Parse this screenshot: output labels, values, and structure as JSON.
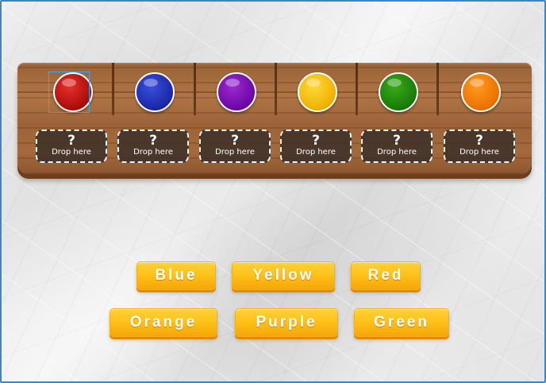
{
  "slots": [
    {
      "color_name": "red",
      "color": "#c81414",
      "placeholder_mark": "?",
      "placeholder_text": "Drop here"
    },
    {
      "color_name": "blue",
      "color": "#1c2fb4",
      "placeholder_mark": "?",
      "placeholder_text": "Drop here"
    },
    {
      "color_name": "purple",
      "color": "#7a0ab0",
      "placeholder_mark": "?",
      "placeholder_text": "Drop here"
    },
    {
      "color_name": "yellow",
      "color": "#f5c000",
      "placeholder_mark": "?",
      "placeholder_text": "Drop here"
    },
    {
      "color_name": "green",
      "color": "#1e8a0a",
      "placeholder_mark": "?",
      "placeholder_text": "Drop here"
    },
    {
      "color_name": "orange",
      "color": "#ee7a00",
      "placeholder_mark": "?",
      "placeholder_text": "Drop here"
    }
  ],
  "words": {
    "row1": [
      "Blue",
      "Yellow",
      "Red"
    ],
    "row2": [
      "Orange",
      "Purple",
      "Green"
    ]
  },
  "selected_slot": 0,
  "accent_color": "#ffc21a",
  "frame_color": "#3a86c8"
}
